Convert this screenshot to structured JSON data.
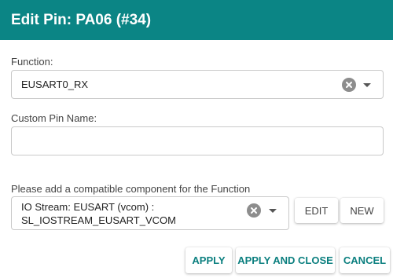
{
  "dialog": {
    "title": "Edit Pin: PA06 (#34)"
  },
  "function_field": {
    "label": "Function:",
    "value": "EUSART0_RX"
  },
  "custom_name_field": {
    "label": "Custom Pin Name:",
    "value": ""
  },
  "component_field": {
    "label": "Please add a compatible component for the Function",
    "value_line1": "IO Stream: EUSART (vcom) :",
    "value_line2": "SL_IOSTREAM_EUSART_VCOM",
    "edit_label": "EDIT",
    "new_label": "NEW"
  },
  "footer": {
    "apply_label": "APPLY",
    "apply_close_label": "APPLY AND CLOSE",
    "cancel_label": "CANCEL"
  },
  "colors": {
    "header_bg": "#0b8585",
    "accent_text": "#0b7f7f"
  },
  "icons": [
    "clear-icon",
    "chevron-down-icon"
  ]
}
